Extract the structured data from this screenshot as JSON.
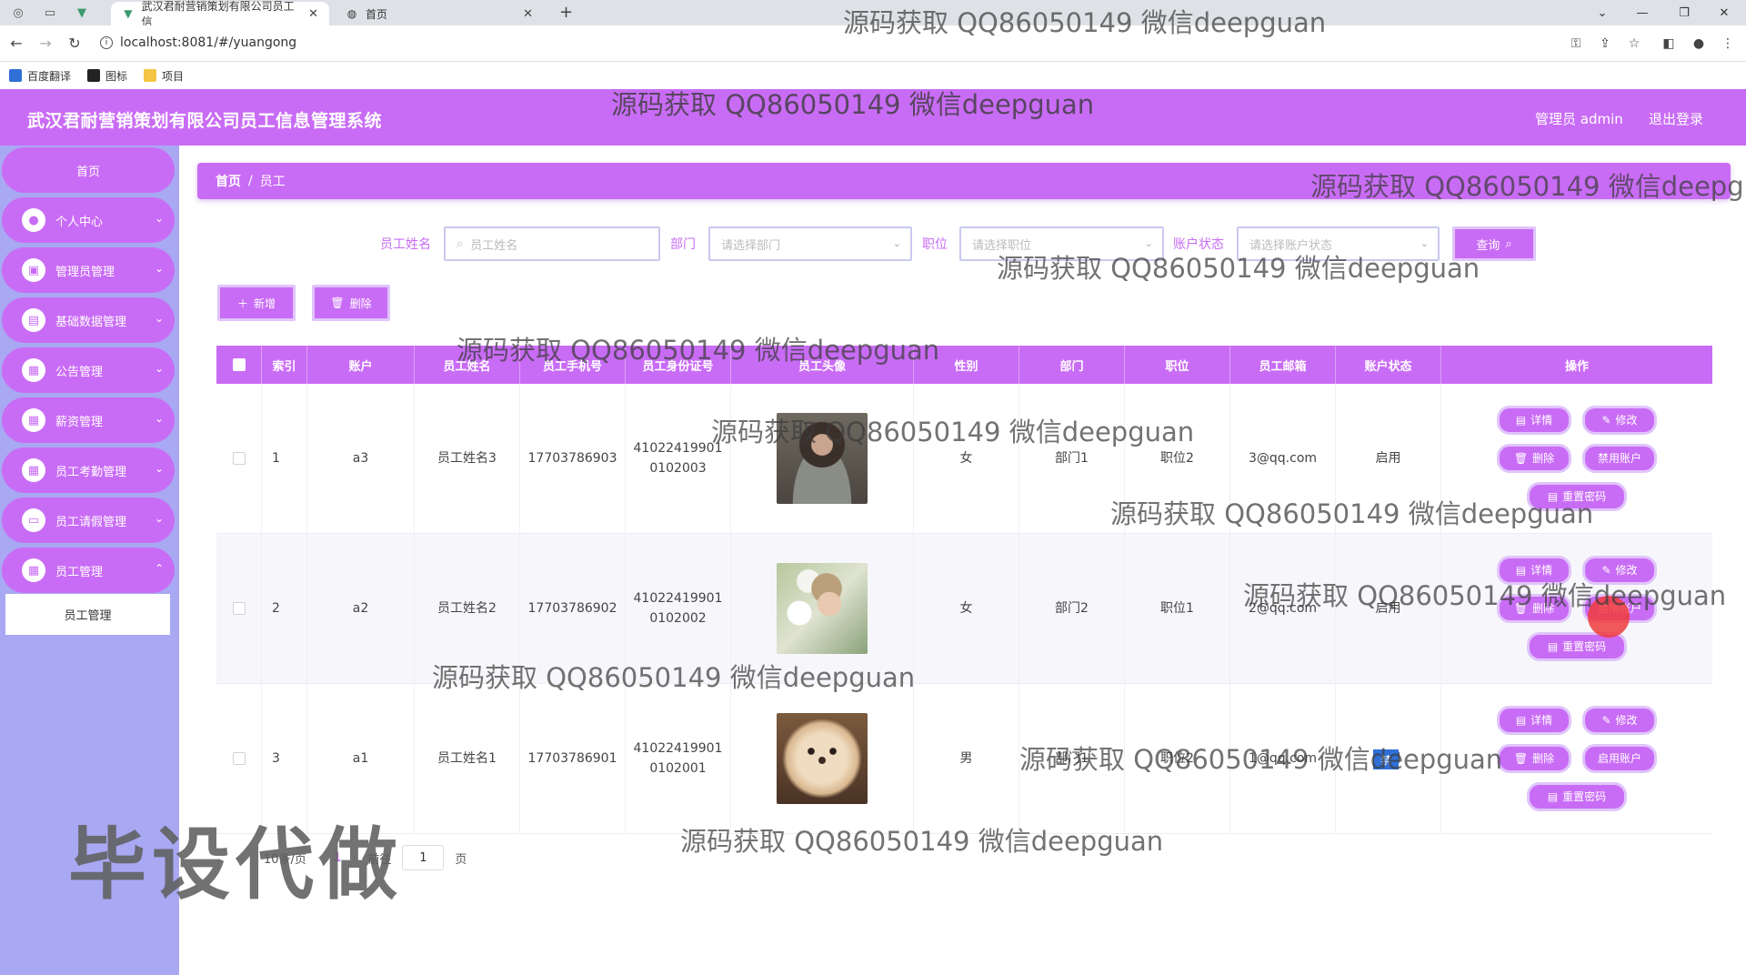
{
  "browser": {
    "tabs": [
      {
        "title": "武汉君耐营销策划有限公司员工信",
        "active": true
      },
      {
        "title": "首页",
        "active": false
      }
    ],
    "url": "localhost:8081/#/yuangong",
    "bookmarks": [
      "百度翻译",
      "图标",
      "项目"
    ]
  },
  "header": {
    "title": "武汉君耐营销策划有限公司员工信息管理系统",
    "user": "管理员 admin",
    "logout": "退出登录"
  },
  "sidebar": {
    "home": "首页",
    "items": [
      {
        "label": "个人中心",
        "icon": "user-icon"
      },
      {
        "label": "管理员管理",
        "icon": "admin-icon"
      },
      {
        "label": "基础数据管理",
        "icon": "clipboard-icon"
      },
      {
        "label": "公告管理",
        "icon": "grid-icon"
      },
      {
        "label": "薪资管理",
        "icon": "grid-icon"
      },
      {
        "label": "员工考勤管理",
        "icon": "grid-icon"
      },
      {
        "label": "员工请假管理",
        "icon": "chat-icon"
      },
      {
        "label": "员工管理",
        "icon": "grid-icon"
      }
    ],
    "submenu": "员工管理"
  },
  "breadcrumb": {
    "home": "首页",
    "sep": "/",
    "current": "员工"
  },
  "search": {
    "name_label": "员工姓名",
    "name_placeholder": "员工姓名",
    "dept_label": "部门",
    "dept_placeholder": "请选择部门",
    "pos_label": "职位",
    "pos_placeholder": "请选择职位",
    "status_label": "账户状态",
    "status_placeholder": "请选择账户状态",
    "query": "查询"
  },
  "actions": {
    "add": "新增",
    "delete": "删除"
  },
  "table": {
    "headers": [
      "索引",
      "账户",
      "员工姓名",
      "员工手机号",
      "员工身份证号",
      "员工头像",
      "性别",
      "部门",
      "职位",
      "员工邮箱",
      "账户状态",
      "操作"
    ],
    "rows": [
      {
        "index": "1",
        "account": "a3",
        "name": "员工姓名3",
        "phone": "17703786903",
        "id_line1": "41022419901",
        "id_line2": "0102003",
        "avatar": "photo-man",
        "gender": "女",
        "dept": "部门1",
        "position": "职位2",
        "email": "3@qq.com",
        "status": "启用",
        "toggle": "禁用账户"
      },
      {
        "index": "2",
        "account": "a2",
        "name": "员工姓名2",
        "phone": "17703786902",
        "id_line1": "41022419901",
        "id_line2": "0102002",
        "avatar": "photo-flowers",
        "gender": "女",
        "dept": "部门2",
        "position": "职位1",
        "email": "2@qq.com",
        "status": "启用",
        "toggle": "禁用账户"
      },
      {
        "index": "3",
        "account": "a1",
        "name": "员工姓名1",
        "phone": "17703786901",
        "id_line1": "41022419901",
        "id_line2": "0102001",
        "avatar": "photo-puppy",
        "gender": "男",
        "dept": "部门1",
        "position": "职位2",
        "email": "1@qq.com",
        "status": "禁用",
        "toggle": "启用账户"
      }
    ],
    "ops": {
      "detail": "详情",
      "edit": "修改",
      "delete": "删除",
      "reset": "重置密码"
    }
  },
  "pager": {
    "per_page": "10条/页",
    "current": "1",
    "goto": "前往",
    "page_input": "1",
    "page_unit": "页"
  },
  "overlays": {
    "watermark": "源码获取 QQ86050149 微信deepguan",
    "big": "毕设代做",
    "selection": "禁"
  },
  "colors": {
    "accent": "#c96cf5",
    "sidebar": "#a9a8f3",
    "accent_light": "#e0c4fb"
  }
}
